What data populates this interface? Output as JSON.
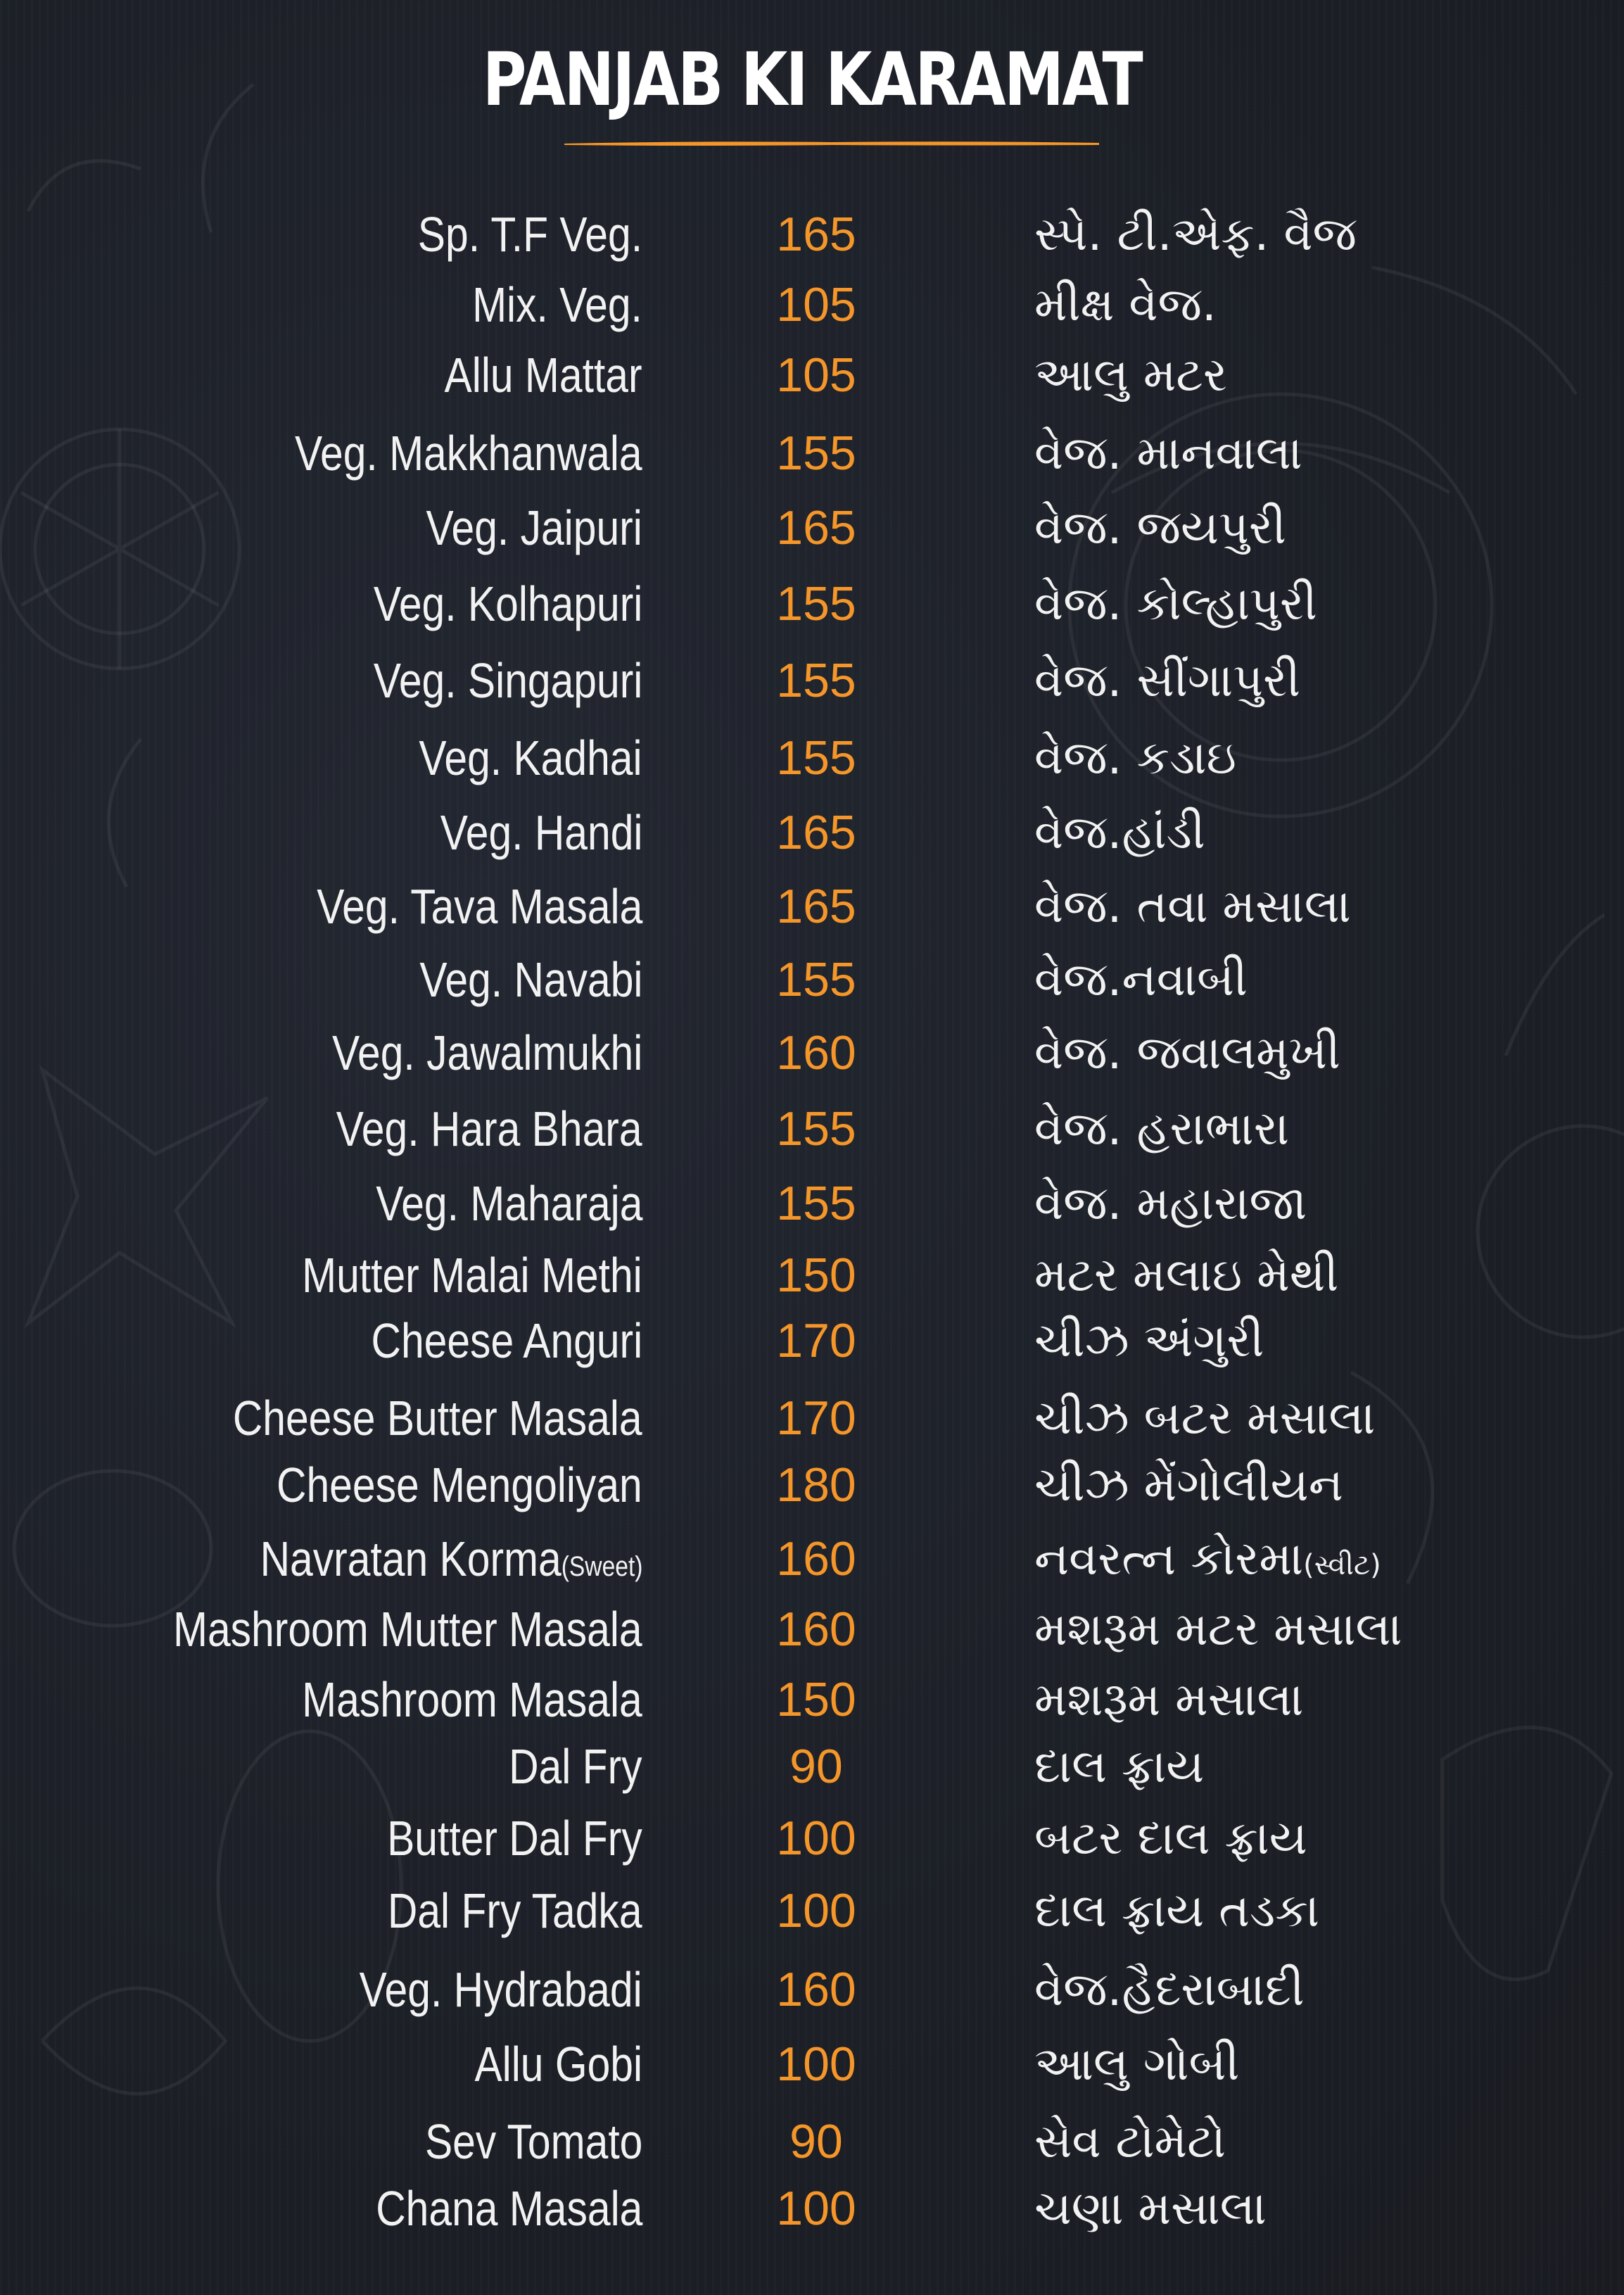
{
  "menu": {
    "title": "PANJAB KI KARAMAT",
    "accent": "#f5962a",
    "items": [
      {
        "name": "Sp. T.F Veg.",
        "price": "165",
        "name_gu": "સ્પે. ટી.એફ. વૈજ"
      },
      {
        "name": "Mix. Veg.",
        "price": "105",
        "name_gu": "મીક્ષ વેજ."
      },
      {
        "name": "Allu Mattar",
        "price": "105",
        "name_gu": "આલુ મટર"
      },
      {
        "name": "Veg. Makkhanwala",
        "price": "155",
        "name_gu": "વેજ. માનવાલા"
      },
      {
        "name": "Veg. Jaipuri",
        "price": "165",
        "name_gu": "વેજ. જયપુરી"
      },
      {
        "name": "Veg. Kolhapuri",
        "price": "155",
        "name_gu": "વેજ. કોલ્હાપુરી"
      },
      {
        "name": "Veg. Singapuri",
        "price": "155",
        "name_gu": "વેજ. સીંગાપુરી"
      },
      {
        "name": "Veg. Kadhai",
        "price": "155",
        "name_gu": "વેજ. કડાઇ"
      },
      {
        "name": "Veg. Handi",
        "price": "165",
        "name_gu": "વેજ.હાંડી"
      },
      {
        "name": "Veg. Tava Masala",
        "price": "165",
        "name_gu": "વેજ. તવા મસાલા"
      },
      {
        "name": "Veg. Navabi",
        "price": "155",
        "name_gu": "વેજ.નવાબી"
      },
      {
        "name": "Veg. Jawalmukhi",
        "price": "160",
        "name_gu": "વેજ. જવાલમુખી"
      },
      {
        "name": "Veg. Hara Bhara",
        "price": "155",
        "name_gu": "વેજ. હરાભારા"
      },
      {
        "name": "Veg. Maharaja",
        "price": "155",
        "name_gu": "વેજ. મહારાજા"
      },
      {
        "name": "Mutter Malai Methi",
        "price": "150",
        "name_gu": "મટર મલાઇ મેથી"
      },
      {
        "name": "Cheese Anguri",
        "price": "170",
        "name_gu": "ચીઝ અંગુરી"
      },
      {
        "name": "Cheese Butter Masala",
        "price": "170",
        "name_gu": "ચીઝ બટર મસાલા"
      },
      {
        "name": "Cheese Mengoliyan",
        "price": "180",
        "name_gu": "ચીઝ મેંગોલીયન"
      },
      {
        "name": "Navratan Korma",
        "note": "(Sweet)",
        "price": "160",
        "name_gu": "નવરત્ન કોરમા",
        "note_gu": "(સ્વીટ)"
      },
      {
        "name": "Mashroom Mutter Masala",
        "price": "160",
        "name_gu": "મશરૂમ મટર મસાલા"
      },
      {
        "name": "Mashroom Masala",
        "price": "150",
        "name_gu": "મશરૂમ મસાલા"
      },
      {
        "name": "Dal Fry",
        "price": "90",
        "name_gu": "દાલ ફ્રાય"
      },
      {
        "name": "Butter Dal Fry",
        "price": "100",
        "name_gu": "બટર દાલ ફ્રાય"
      },
      {
        "name": "Dal Fry Tadka",
        "price": "100",
        "name_gu": "દાલ ફ્રાય તડકા"
      },
      {
        "name": "Veg. Hydrabadi",
        "price": "160",
        "name_gu": "વેજ.હૈદરાબાદી"
      },
      {
        "name": "Allu Gobi",
        "price": "100",
        "name_gu": "આલુ ગોબી"
      },
      {
        "name": "Sev Tomato",
        "price": "90",
        "name_gu": "સેવ ટોમેટો"
      },
      {
        "name": "Chana Masala",
        "price": "100",
        "name_gu": "ચણા મસાલા"
      }
    ]
  }
}
